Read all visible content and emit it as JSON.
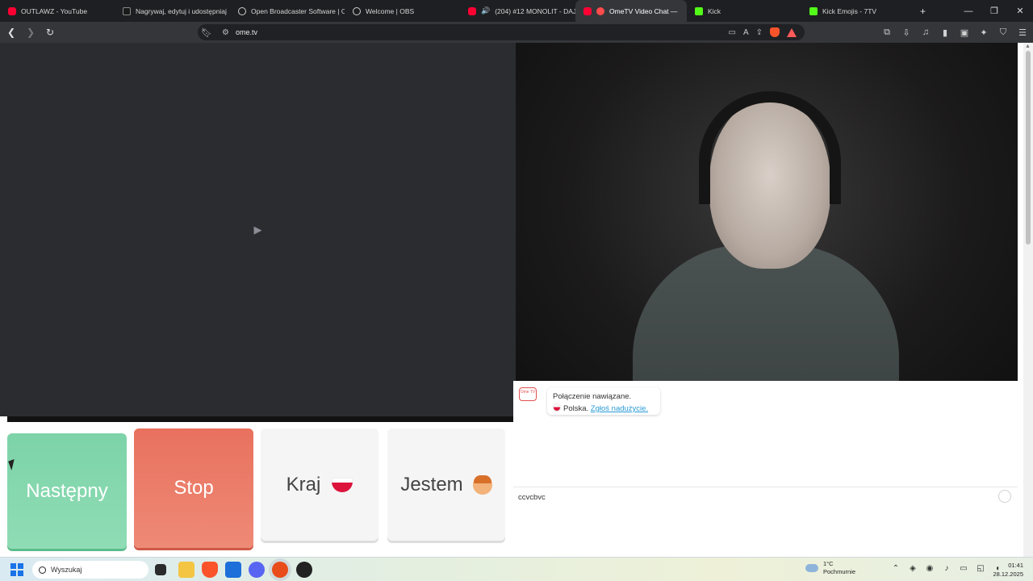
{
  "tabs": [
    {
      "label": "OUTLAWZ - YouTube",
      "icon": "youtube-icon",
      "active": false
    },
    {
      "label": "Nagrywaj, edytuj i udostępniaj",
      "icon": "app-icon",
      "active": false
    },
    {
      "label": "Open Broadcaster Software | O",
      "icon": "globe-icon",
      "active": false
    },
    {
      "label": "Welcome | OBS",
      "icon": "globe-icon",
      "active": false
    },
    {
      "label": "(204) #12 MONOLIT - DAJ",
      "icon": "youtube-icon",
      "active": false
    },
    {
      "label": "OmeTV Video Chat — ",
      "icon": "ometv-icon",
      "active": true
    },
    {
      "label": "Kick",
      "icon": "kick-icon",
      "active": false
    },
    {
      "label": "Kick Emojis - 7TV",
      "icon": "kick-icon",
      "active": false
    }
  ],
  "address_bar": {
    "url": "ome.tv"
  },
  "controls": {
    "next_label": "Następny",
    "stop_label": "Stop",
    "country_label": "Kraj",
    "gender_label": "Jestem"
  },
  "chat": {
    "logo_text": "Ome TV",
    "status_line": "Połączenie nawiązane.",
    "country_text": "Polska.",
    "report_link": "Zgłoś nadużycie.",
    "input_value": "ccvcbvc"
  },
  "taskbar": {
    "search_placeholder": "Wyszukaj",
    "weather_temp": "1°C",
    "weather_desc": "Pochmurnie",
    "time": "01:41",
    "date": "28.12.2025"
  },
  "colors": {
    "next_button": "#7dd3a8",
    "stop_button": "#e8715e",
    "neutral_button": "#f5f5f5",
    "link": "#2a9bd6"
  }
}
